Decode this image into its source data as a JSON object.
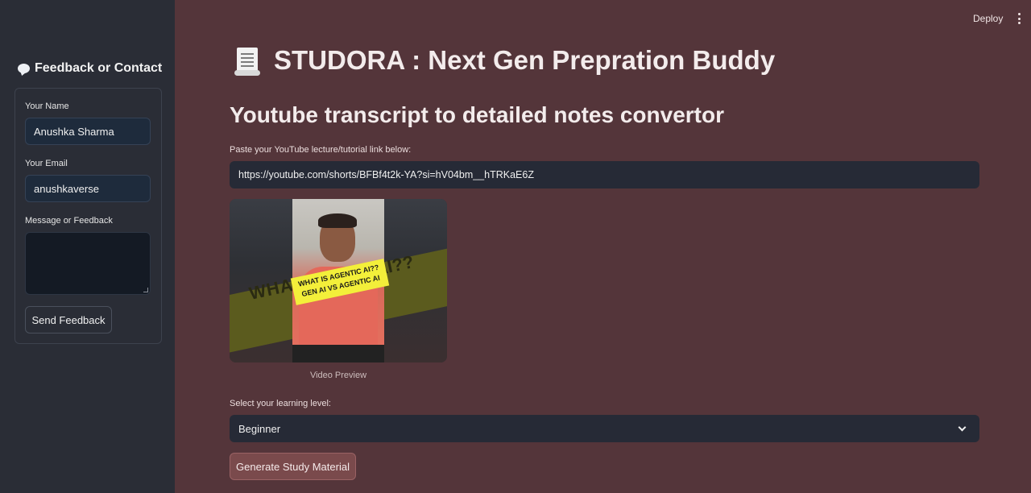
{
  "header": {
    "deploy_label": "Deploy"
  },
  "sidebar": {
    "title": "Feedback or Contact",
    "name_label": "Your Name",
    "name_value": "Anushka Sharma",
    "email_label": "Your Email",
    "email_value": "anushkaverse",
    "message_label": "Message or Feedback",
    "message_value": "",
    "send_button": "Send Feedback"
  },
  "main": {
    "title": "STUDORA : Next Gen Prepration Buddy",
    "subtitle": "Youtube transcript to detailed notes convertor",
    "link_label": "Paste your YouTube lecture/tutorial link below:",
    "link_value": "https://youtube.com/shorts/BFBf4t2k-YA?si=hV04bm__hTRKaE6Z",
    "video_overlay_line1": "WHAT IS AGENTIC AI??",
    "video_overlay_line2": "GEN AI VS AGENTIC AI",
    "video_caption": "Video Preview",
    "level_label": "Select your learning level:",
    "level_value": "Beginner",
    "generate_button": "Generate Study Material"
  },
  "icons": {
    "sidebar_title_icon": "speech-bubble-icon",
    "title_icon": "scroll-icon",
    "menu_icon": "kebab-menu-icon",
    "select_icon": "chevron-down-icon"
  }
}
